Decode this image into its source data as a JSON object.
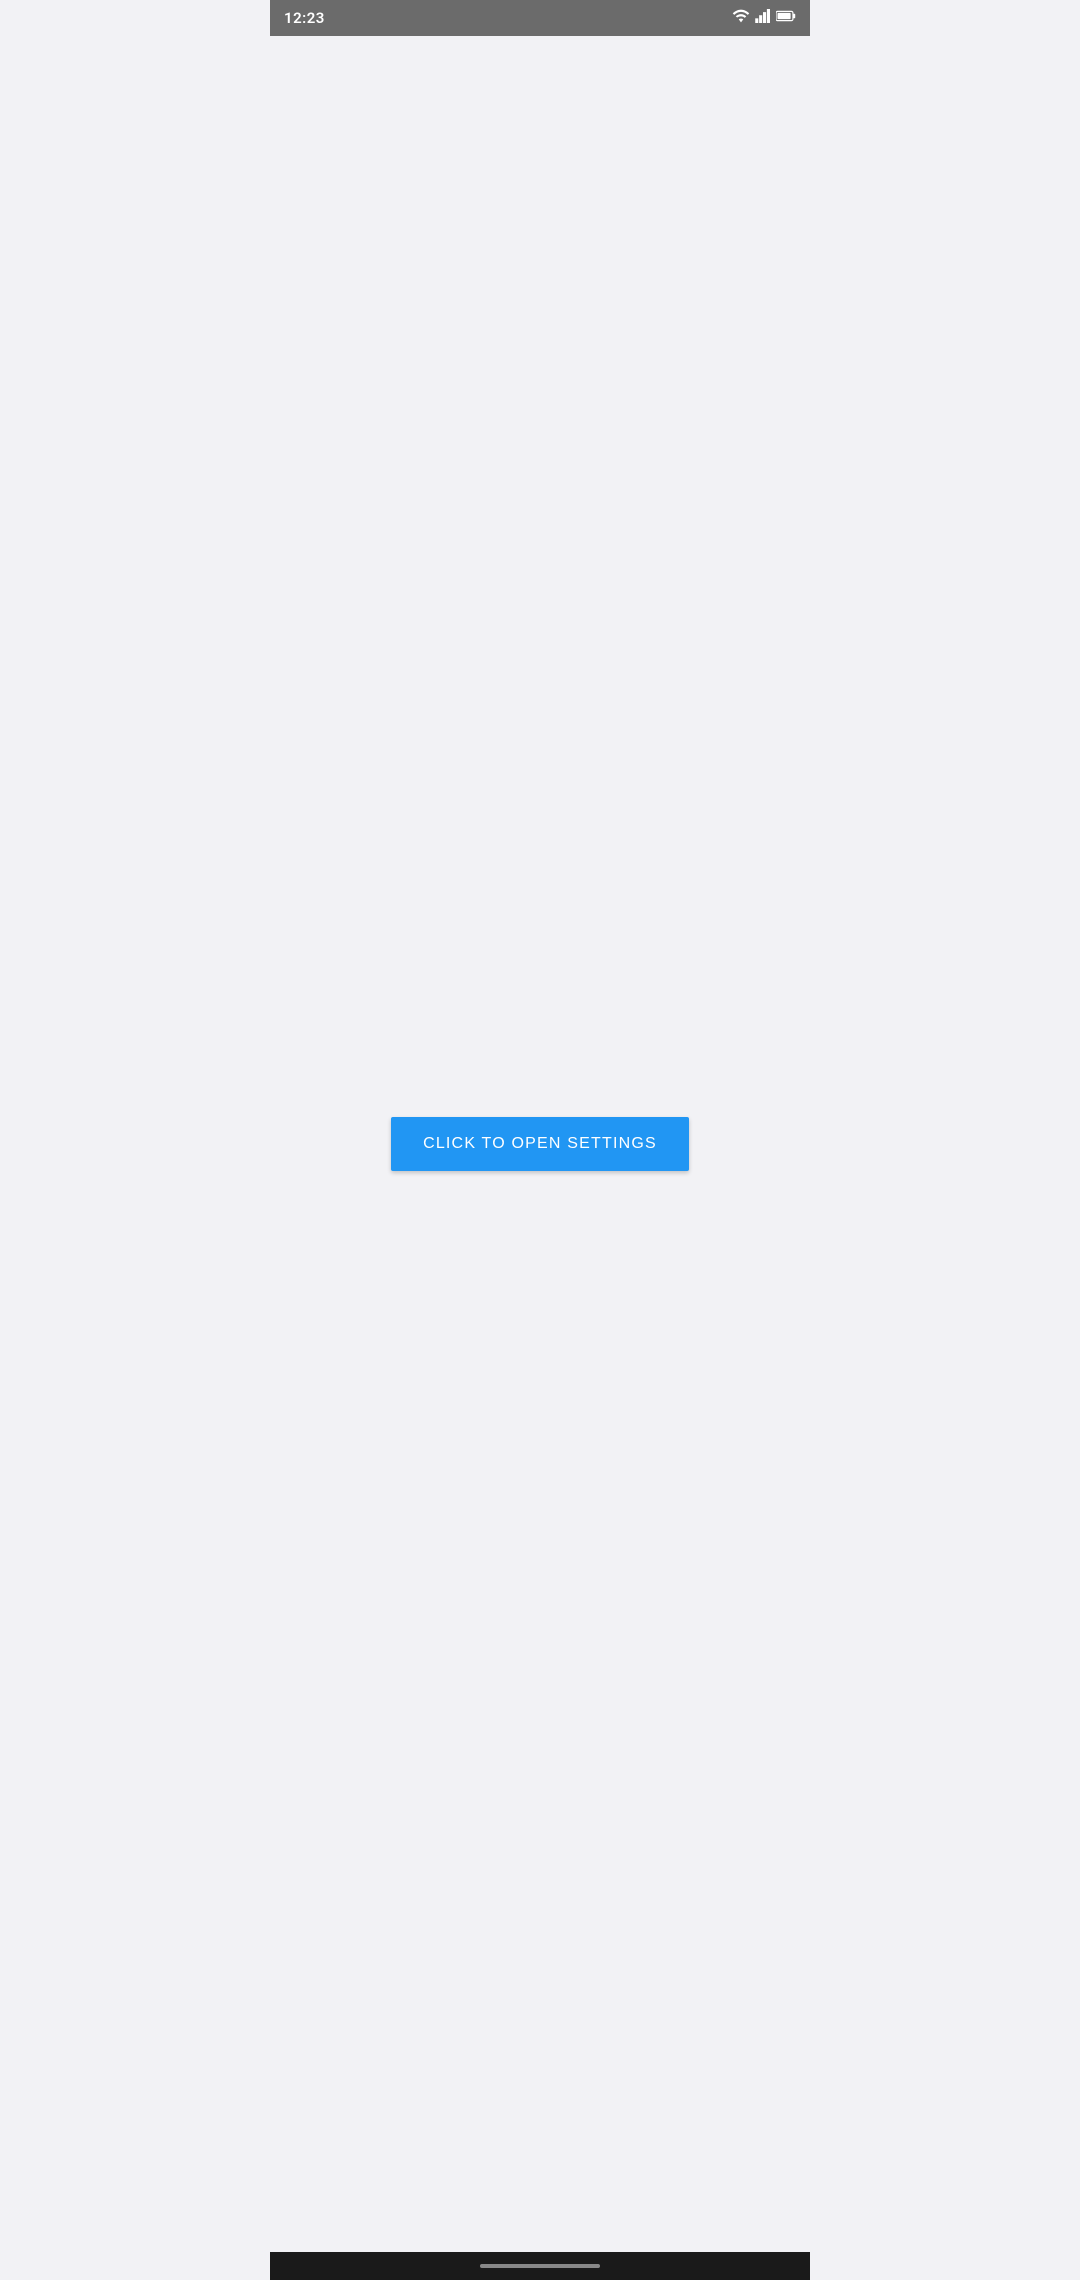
{
  "status_bar": {
    "time": "12:23",
    "wifi_label": "wifi",
    "signal_label": "signal",
    "battery_label": "battery"
  },
  "main": {
    "open_settings_button_label": "CLICK TO OPEN SETTINGS"
  }
}
